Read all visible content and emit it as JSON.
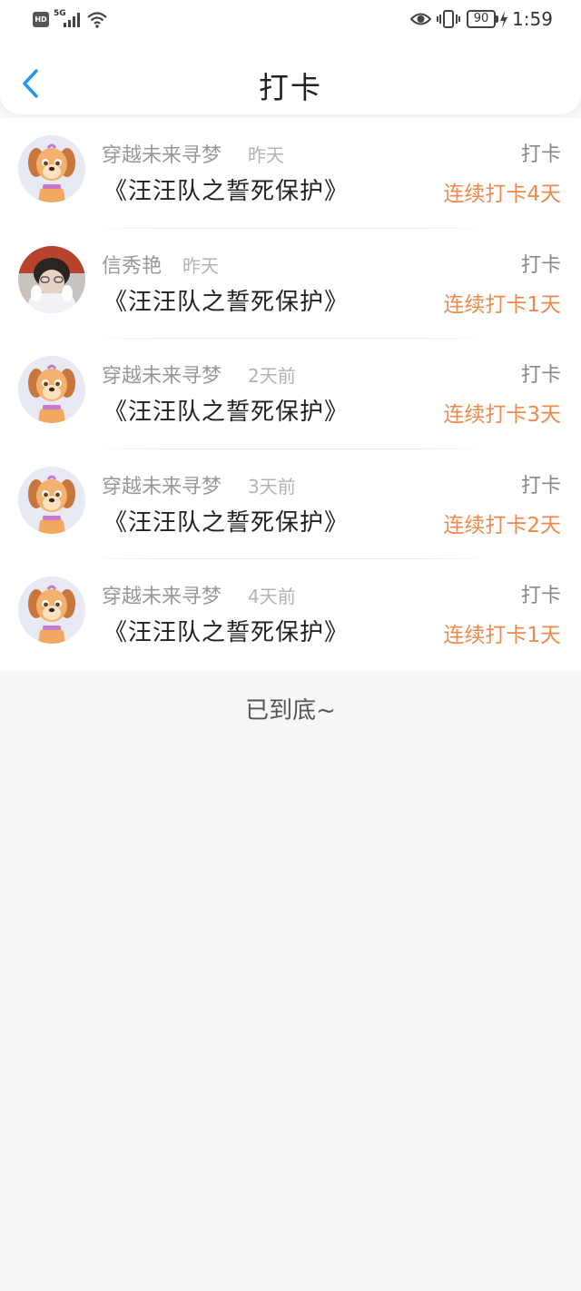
{
  "status_bar": {
    "hd_badge": "HD",
    "network": "5G",
    "battery": "90",
    "time": "1:59"
  },
  "nav": {
    "back_icon": "chevron-left-icon",
    "title": "打卡",
    "accent_color": "#2196f3"
  },
  "checkins": [
    {
      "user": "穿越未来寻梦",
      "time": "昨天",
      "book": "《汪汪队之誓死保护》",
      "action": "打卡",
      "streak": "连续打卡4天",
      "avatar": "cartoon-dog-avatar"
    },
    {
      "user": "信秀艳",
      "time": "昨天",
      "book": "《汪汪队之誓死保护》",
      "action": "打卡",
      "streak": "连续打卡1天",
      "avatar": "photo-avatar"
    },
    {
      "user": "穿越未来寻梦",
      "time": "2天前",
      "book": "《汪汪队之誓死保护》",
      "action": "打卡",
      "streak": "连续打卡3天",
      "avatar": "cartoon-dog-avatar"
    },
    {
      "user": "穿越未来寻梦",
      "time": "3天前",
      "book": "《汪汪队之誓死保护》",
      "action": "打卡",
      "streak": "连续打卡2天",
      "avatar": "cartoon-dog-avatar"
    },
    {
      "user": "穿越未来寻梦",
      "time": "4天前",
      "book": "《汪汪队之誓死保护》",
      "action": "打卡",
      "streak": "连续打卡1天",
      "avatar": "cartoon-dog-avatar"
    }
  ],
  "footer": {
    "end_text": "已到底~"
  },
  "colors": {
    "streak": "#f0894a",
    "secondary_text": "#999999",
    "background": "#f8f7f8"
  }
}
